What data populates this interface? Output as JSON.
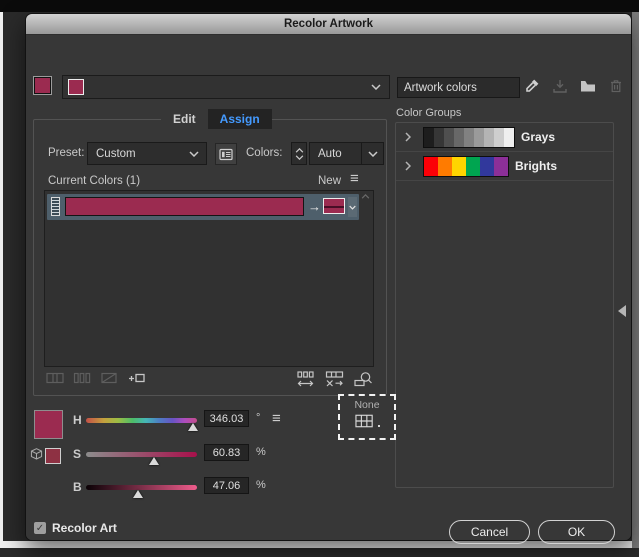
{
  "window": {
    "title": "Recolor Artwork"
  },
  "toolbar": {
    "group_name_value": "Artwork colors",
    "icons": [
      "eyedropper",
      "save-group",
      "new-color-group-folder",
      "delete-group"
    ]
  },
  "tabs": {
    "edit": "Edit",
    "assign": "Assign",
    "active": "Assign"
  },
  "assign_panel": {
    "preset_label": "Preset:",
    "preset_value": "Custom",
    "colors_label": "Colors:",
    "colors_value": "Auto",
    "current_colors_label": "Current Colors (1)",
    "new_label": "New"
  },
  "sliders": {
    "h": {
      "label": "H",
      "value": "346.03",
      "unit": "°",
      "percent": 96
    },
    "s": {
      "label": "S",
      "value": "60.83",
      "unit": "%",
      "percent": 61
    },
    "b": {
      "label": "B",
      "value": "47.06",
      "unit": "%",
      "percent": 47
    }
  },
  "drag_tooltip": {
    "label": "None"
  },
  "color_groups": {
    "title": "Color Groups",
    "groups": [
      {
        "name": "Grays",
        "swatches": [
          "#1d1d1d",
          "#363636",
          "#4f4f4f",
          "#686868",
          "#818181",
          "#9a9a9a",
          "#b4b4b4",
          "#cecece",
          "#efefef"
        ]
      },
      {
        "name": "Brights",
        "swatches": [
          "#fb0007",
          "#ff7b00",
          "#ffd500",
          "#00a550",
          "#31389c",
          "#8c2f98"
        ]
      }
    ]
  },
  "footer": {
    "checkbox_label": "Recolor Art",
    "checkbox_checked": true,
    "cancel_label": "Cancel",
    "ok_label": "OK"
  },
  "colors": {
    "current": "#9b2b50",
    "new_color": "#9b2b50",
    "mini_swatch": "#8e3143",
    "selection_row": "#4e5f6b",
    "accent_blue": "#449aff",
    "title_text": "#1b1b1b"
  },
  "glyphs": {
    "hamburger": "≡",
    "arrow_right": "→",
    "check": "✓"
  }
}
